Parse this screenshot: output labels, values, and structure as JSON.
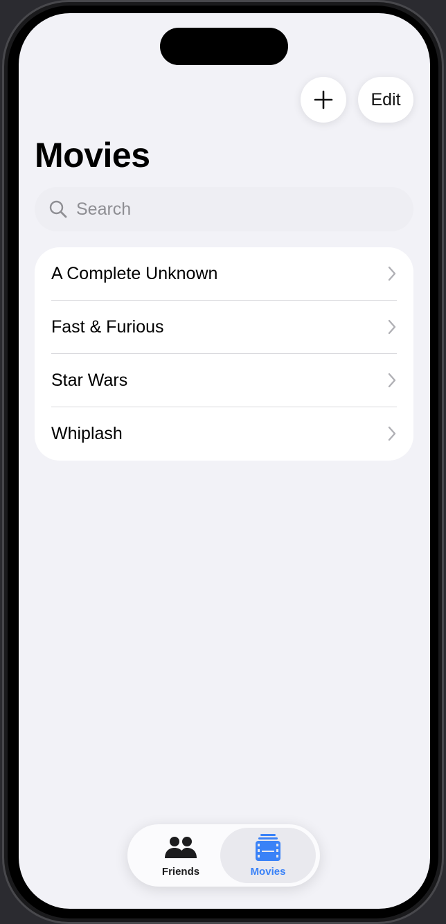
{
  "toolbar": {
    "add_icon": "plus-icon",
    "edit_label": "Edit"
  },
  "page": {
    "title": "Movies"
  },
  "search": {
    "icon": "magnifying-glass-icon",
    "placeholder": "Search",
    "value": ""
  },
  "movies": {
    "items": [
      {
        "title": "A Complete Unknown"
      },
      {
        "title": "Fast & Furious"
      },
      {
        "title": "Star Wars"
      },
      {
        "title": "Whiplash"
      }
    ],
    "row_icon": "chevron-right-icon"
  },
  "tabs": {
    "selected": "Movies",
    "items": [
      {
        "label": "Friends",
        "icon": "person-2-fill-icon"
      },
      {
        "label": "Movies",
        "icon": "film-stack-icon"
      }
    ]
  },
  "colors": {
    "accent": "#3a82f7",
    "background": "#f2f2f7",
    "card": "#ffffff",
    "secondary_text": "#8e8e93"
  }
}
